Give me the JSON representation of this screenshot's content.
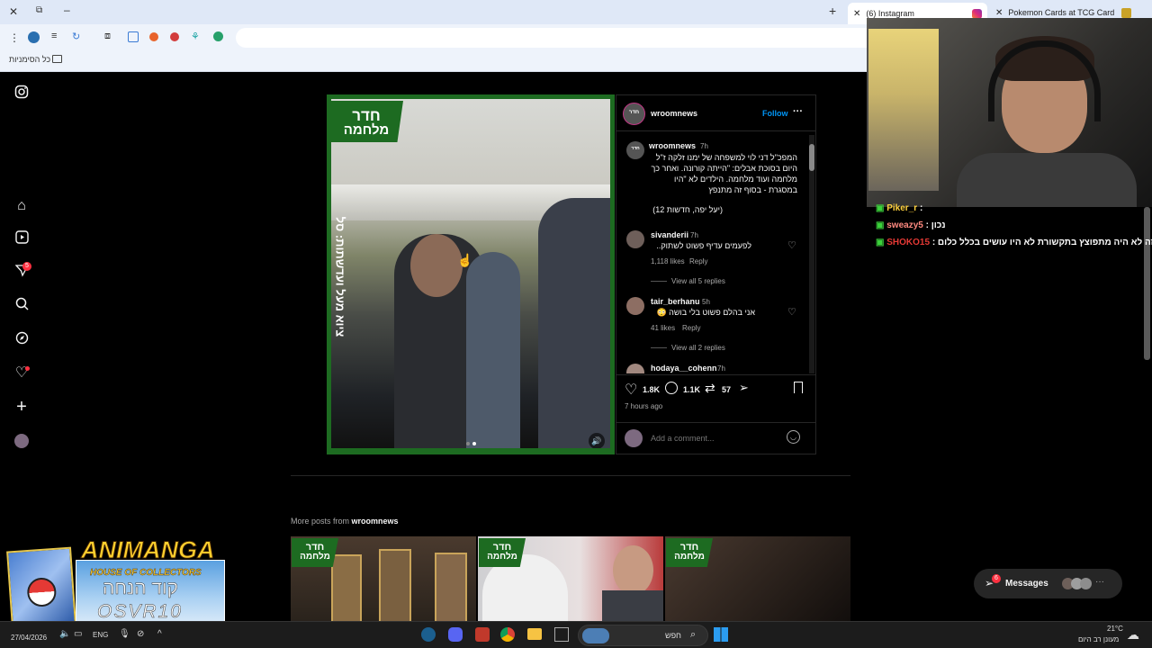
{
  "browser": {
    "tabs": [
      {
        "label": "(6) Instagram",
        "active": true
      },
      {
        "label": "Pokemon Cards at TCG Card Sh",
        "active": false
      }
    ],
    "bookmarks_label": "כל הסימניות"
  },
  "instagram": {
    "media": {
      "logo_line1": "חדר",
      "logo_line2": "מלחמה",
      "side_text": "ציוא מעל ועדשתות: סל"
    },
    "post": {
      "author": "wroomnews",
      "follow_label": "Follow",
      "more_label": "···",
      "caption_author": "wroomnews",
      "caption_time": "7h",
      "caption_text": "המפכ\"ל דני לוי למשפחה של ימנו זלקה ז\"ל היום בסוכת אבלים: \"הייתה קורונה. ואחר כך מלחמה ועוד מלחמה. הילדים לא \"היו במסגרת - בסוף זה מתנפץ",
      "caption_credit": "(יעל יפה, חדשות 12)",
      "comments": [
        {
          "user": "sivanderii",
          "time": "7h",
          "text": "לפעמים עדיף פשוט לשתוק..",
          "likes": "1,118 likes",
          "reply": "Reply",
          "view_replies": "View all 5 replies"
        },
        {
          "user": "tair_berhanu",
          "time": "5h",
          "text": "אני בהלם פשוט בלי בושה 😳",
          "likes": "41 likes",
          "reply": "Reply",
          "view_replies": "View all 2 replies"
        },
        {
          "user": "hodaya__cohenn",
          "time": "7h",
          "text": ""
        }
      ],
      "likes_count": "1.8K",
      "comments_count": "1.1K",
      "reposts_count": "57",
      "posted_ago": "7 hours ago",
      "comment_placeholder": "Add a comment..."
    },
    "more_posts_prefix": "More posts from",
    "more_posts_user": "wroomnews",
    "thumb_logo_line1": "חדר",
    "thumb_logo_line2": "מלחמה",
    "messages_label": "Messages",
    "messages_badge": "6",
    "notif_badge": "5"
  },
  "stream_chat": [
    {
      "user": "Piker_r",
      "text": ":",
      "color": "#ffd23f"
    },
    {
      "user": "sweazy5",
      "text": ": נכון",
      "color": "#ff8a80"
    },
    {
      "user": "SHOKO15",
      "text": ": זה לא היה מתפוצץ בתקשורת לא היו עושים בכלל כלום",
      "color": "#e53935"
    }
  ],
  "overlay": {
    "brand": "ANIMANGA",
    "brand_sub": "HOUSE OF COLLECTORS",
    "code_label": "קוד הנחה",
    "code": "OSVR10"
  },
  "taskbar": {
    "date": "27/04/2026",
    "lang": "ENG",
    "search_placeholder": "חפש",
    "temperature": "21°C",
    "weather": "מעונן רב היום"
  },
  "colors": {
    "accent_blue": "#0095f6",
    "brand_green": "#1d6b21",
    "badge_red": "#ff3040"
  }
}
